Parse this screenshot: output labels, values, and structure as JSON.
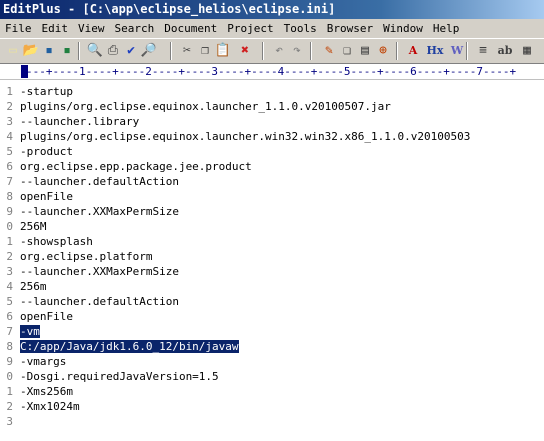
{
  "window": {
    "title": "EditPlus - [C:\\app\\eclipse_helios\\eclipse.ini]"
  },
  "menu": [
    "File",
    "Edit",
    "View",
    "Search",
    "Document",
    "Project",
    "Tools",
    "Browser",
    "Window",
    "Help"
  ],
  "toolbar": {
    "icons": [
      {
        "name": "new-icon",
        "glyph": "▭",
        "color": "#e8e0a0"
      },
      {
        "name": "open-icon",
        "glyph": "📂",
        "color": "#d4a020"
      },
      {
        "name": "save-icon",
        "glyph": "▪",
        "color": "#2060a0"
      },
      {
        "name": "save-all-icon",
        "glyph": "▪",
        "color": "#208040"
      },
      {
        "name": "print-preview-icon",
        "glyph": "🔍",
        "color": "#404040"
      },
      {
        "name": "print-icon",
        "glyph": "⎙",
        "color": "#404040"
      },
      {
        "name": "spell-check-icon",
        "glyph": "✔",
        "color": "#2040c0"
      },
      {
        "name": "find-icon",
        "glyph": "🔎",
        "color": "#404040"
      },
      {
        "name": "cut-icon",
        "glyph": "✂",
        "color": "#404040"
      },
      {
        "name": "copy-icon",
        "glyph": "❐",
        "color": "#404040"
      },
      {
        "name": "paste-icon",
        "glyph": "📋",
        "color": "#a07020"
      },
      {
        "name": "delete-icon",
        "glyph": "✖",
        "color": "#d02020"
      },
      {
        "name": "undo-icon",
        "glyph": "↶",
        "color": "#808080"
      },
      {
        "name": "redo-icon",
        "glyph": "↷",
        "color": "#808080"
      },
      {
        "name": "pen-icon",
        "glyph": "✎",
        "color": "#c04000"
      },
      {
        "name": "copy-format-icon",
        "glyph": "❏",
        "color": "#404040"
      },
      {
        "name": "paste-format-icon",
        "glyph": "▤",
        "color": "#404040"
      },
      {
        "name": "insert-icon",
        "glyph": "⊕",
        "color": "#c04000"
      },
      {
        "name": "text-icon",
        "glyph": "A",
        "color": "#c00000"
      },
      {
        "name": "hex-icon",
        "glyph": "Hx",
        "color": "#2040a0"
      },
      {
        "name": "wordwrap-icon",
        "glyph": "W",
        "color": "#6060c0"
      },
      {
        "name": "list-icon",
        "glyph": "≡",
        "color": "#404040"
      },
      {
        "name": "abcd-icon",
        "glyph": "ab",
        "color": "#404040"
      },
      {
        "name": "ruler-icon",
        "glyph": "▦",
        "color": "#404040"
      }
    ]
  },
  "ruler": {
    "text": "---+----1----+----2----+----3----+----4----+----5----+----6----+----7----+"
  },
  "editor": {
    "lines": [
      "-startup",
      "plugins/org.eclipse.equinox.launcher_1.1.0.v20100507.jar",
      "--launcher.library",
      "plugins/org.eclipse.equinox.launcher.win32.win32.x86_1.1.0.v20100503",
      "-product",
      "org.eclipse.epp.package.jee.product",
      "--launcher.defaultAction",
      "openFile",
      "--launcher.XXMaxPermSize",
      "256M",
      "-showsplash",
      "org.eclipse.platform",
      "--launcher.XXMaxPermSize",
      "256m",
      "--launcher.defaultAction",
      "openFile",
      "-vm",
      "C:/app/Java/jdk1.6.0_12/bin/javaw",
      "-vmargs",
      "-Dosgi.requiredJavaVersion=1.5",
      "-Xms256m",
      "-Xmx1024m",
      ""
    ],
    "line_numbers": [
      "1",
      "2",
      "3",
      "4",
      "5",
      "6",
      "7",
      "8",
      "9",
      "0",
      "1",
      "2",
      "3",
      "4",
      "5",
      "6",
      "7",
      "8",
      "9",
      "0",
      "1",
      "2",
      "3"
    ],
    "selected_lines": [
      17,
      18
    ]
  }
}
